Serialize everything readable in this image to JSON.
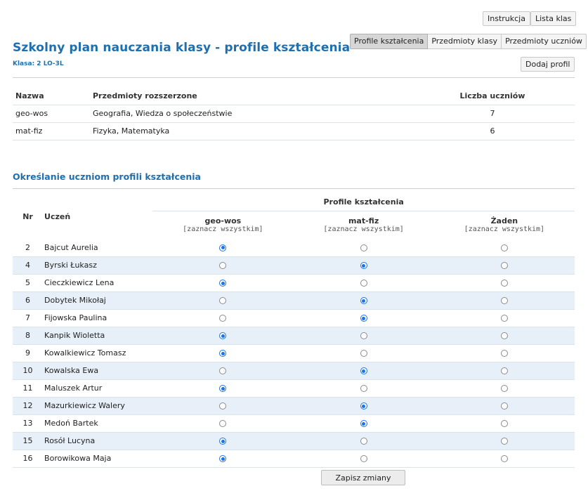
{
  "top_buttons": {
    "instrukcja": "Instrukcja",
    "lista_klas": "Lista klas"
  },
  "tabs": [
    {
      "label": "Profile kształcenia",
      "active": true
    },
    {
      "label": "Przedmioty klasy",
      "active": false
    },
    {
      "label": "Przedmioty uczniów",
      "active": false
    }
  ],
  "add_profile": "Dodaj profil",
  "page": {
    "title": "Szkolny plan nauczania klasy - profile kształcenia",
    "subtitle": "Klasa: 2 LO-3L"
  },
  "profiles_table": {
    "headers": [
      "Nazwa",
      "Przedmioty rozszerzone",
      "Liczba uczniów"
    ],
    "rows": [
      {
        "name": "geo-wos",
        "subjects": "Geografia, Wiedza o społeczeństwie",
        "count": "7"
      },
      {
        "name": "mat-fiz",
        "subjects": "Fizyka, Matematyka",
        "count": "6"
      }
    ]
  },
  "assign_section": {
    "title": "Określanie uczniom profili kształcenia",
    "col_nr": "Nr",
    "col_student": "Uczeń",
    "group_header": "Profile kształcenia",
    "profile_cols": [
      {
        "name": "geo-wos",
        "select_all": "[zaznacz wszystkim]"
      },
      {
        "name": "mat-fiz",
        "select_all": "[zaznacz wszystkim]"
      },
      {
        "name": "Żaden",
        "select_all": "[zaznacz wszystkim]"
      }
    ],
    "students": [
      {
        "nr": "2",
        "name": "Bajcut Aurelia",
        "selected": 0
      },
      {
        "nr": "4",
        "name": "Byrski Łukasz",
        "selected": 1
      },
      {
        "nr": "5",
        "name": "Cieczkiewicz Lena",
        "selected": 0
      },
      {
        "nr": "6",
        "name": "Dobytek Mikołaj",
        "selected": 1
      },
      {
        "nr": "7",
        "name": "Fijowska Paulina",
        "selected": 1
      },
      {
        "nr": "8",
        "name": "Kanpik Wioletta",
        "selected": 0
      },
      {
        "nr": "9",
        "name": "Kowalkiewicz Tomasz",
        "selected": 0
      },
      {
        "nr": "10",
        "name": "Kowalska Ewa",
        "selected": 1
      },
      {
        "nr": "11",
        "name": "Maluszek Artur",
        "selected": 0
      },
      {
        "nr": "12",
        "name": "Mazurkiewicz Walery",
        "selected": 1
      },
      {
        "nr": "13",
        "name": "Medoń Bartek",
        "selected": 1
      },
      {
        "nr": "15",
        "name": "Rosół Lucyna",
        "selected": 0
      },
      {
        "nr": "16",
        "name": "Borowikowa Maja",
        "selected": 0
      }
    ]
  },
  "save_button": "Zapisz zmiany",
  "colors": {
    "accent": "#1f6fae",
    "row_alt": "#e7f0f8",
    "radio_on": "#1a73e8"
  }
}
